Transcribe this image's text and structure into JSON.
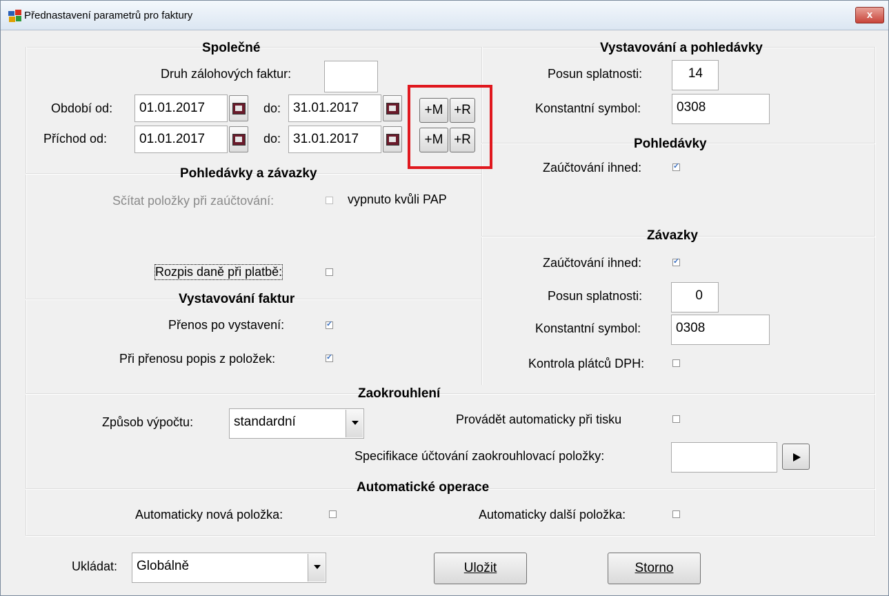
{
  "window": {
    "title": "Přednastavení parametrů pro faktury",
    "close_glyph": "x"
  },
  "icons": {
    "app": "app-icon",
    "calendar": "calendar-icon",
    "play": "play-icon"
  },
  "colors": {
    "highlight": "#e0181e"
  },
  "spolecne": {
    "header": "Společné",
    "druh_label": "Druh zálohových faktur:",
    "druh_value": "",
    "obdobi_label": "Období od:",
    "obdobi_od": "01.01.2017",
    "obdobi_do_label": "do:",
    "obdobi_do": "31.01.2017",
    "prichod_label": "Příchod od:",
    "prichod_od": "01.01.2017",
    "prichod_do_label": "do:",
    "prichod_do": "31.01.2017",
    "plus_m": "+M",
    "plus_r": "+R"
  },
  "pohledavky_zavazky": {
    "header": "Pohledávky  a závazky",
    "scitat_label": "Sčítat položky při zaúčtování:",
    "scitat_checked": false,
    "scitat_note": "vypnuto kvůli PAP",
    "rozpis_label": "Rozpis daně při platbě:",
    "rozpis_checked": false
  },
  "vystavovani_faktur": {
    "header": "Vystavování faktur",
    "prenos_label": "Přenos po vystavení:",
    "prenos_checked": true,
    "popis_label": "Při přenosu popis z položek:",
    "popis_checked": true
  },
  "vystavovani_pohledavky": {
    "header": "Vystavování a pohledávky",
    "posun_label": "Posun splatnosti:",
    "posun_value": "14",
    "ks_label": "Konstantní symbol:",
    "ks_value": "0308"
  },
  "pohledavky": {
    "header": "Pohledávky",
    "zauct_label": "Zaúčtování ihned:",
    "zauct_checked": true
  },
  "zavazky": {
    "header": "Závazky",
    "zauct_label": "Zaúčtování ihned:",
    "zauct_checked": true,
    "posun_label": "Posun splatnosti:",
    "posun_value": "0",
    "ks_label": "Konstantní symbol:",
    "ks_value": "0308",
    "kontrola_label": "Kontrola plátců DPH:",
    "kontrola_checked": false
  },
  "zaokrouhleni": {
    "header": "Zaokrouhlení",
    "zpusob_label": "Způsob výpočtu:",
    "zpusob_value": "standardní",
    "provadet_label": "Provádět automaticky při tisku",
    "provadet_checked": false,
    "spec_label": "Specifikace účtování zaokrouhlovací položky:",
    "spec_value": ""
  },
  "automaticke": {
    "header": "Automatické operace",
    "nova_label": "Automaticky nová položka:",
    "nova_checked": false,
    "dalsi_label": "Automaticky další položka:",
    "dalsi_checked": false
  },
  "footer": {
    "ukladat_label": "Ukládat:",
    "ukladat_value": "Globálně",
    "ulozit_label": "Uložit",
    "storno_label": "Storno"
  }
}
